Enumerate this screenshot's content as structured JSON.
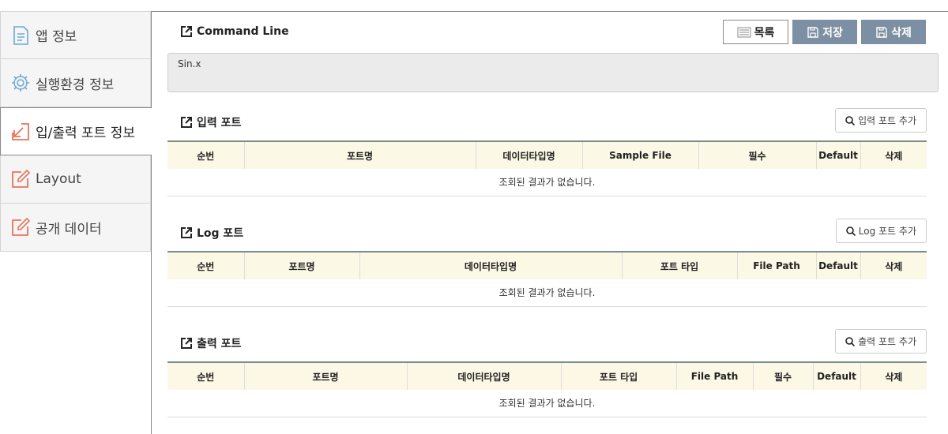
{
  "sidebar": {
    "items": [
      {
        "label": "앱 정보",
        "icon": "document-icon"
      },
      {
        "label": "실행환경 정보",
        "icon": "gear-icon"
      },
      {
        "label": "입/출력 포트 정보",
        "icon": "import-icon"
      },
      {
        "label": "Layout",
        "icon": "edit-icon"
      },
      {
        "label": "공개 데이터",
        "icon": "edit-icon"
      }
    ],
    "active_index": 2
  },
  "command": {
    "title": "Command Line",
    "value": "Sin.x"
  },
  "toolbar": {
    "list_label": "목록",
    "save_label": "저장",
    "delete_label": "삭제"
  },
  "sections": {
    "input": {
      "title": "입력 포트",
      "add_label": "입력 포트 추가",
      "columns": [
        "순번",
        "포트명",
        "데이터타입명",
        "Sample File",
        "필수",
        "Default",
        "삭제"
      ],
      "empty": "조회된 결과가 없습니다."
    },
    "log": {
      "title": "Log 포트",
      "add_label": "Log 포트 추가",
      "columns": [
        "순번",
        "포트명",
        "데이터타입명",
        "포트 타입",
        "File Path",
        "Default",
        "삭제"
      ],
      "empty": "조회된 결과가 없습니다."
    },
    "output": {
      "title": "출력 포트",
      "add_label": "출력 포트 추가",
      "columns": [
        "순번",
        "포트명",
        "데이터타입명",
        "포트 타입",
        "File Path",
        "필수",
        "Default",
        "삭제"
      ],
      "empty": "조회된 결과가 없습니다."
    }
  },
  "colors": {
    "accent_icon": "#e8735a",
    "button_gray": "#7d8fa3",
    "table_header_bg": "#fbf8e6"
  }
}
